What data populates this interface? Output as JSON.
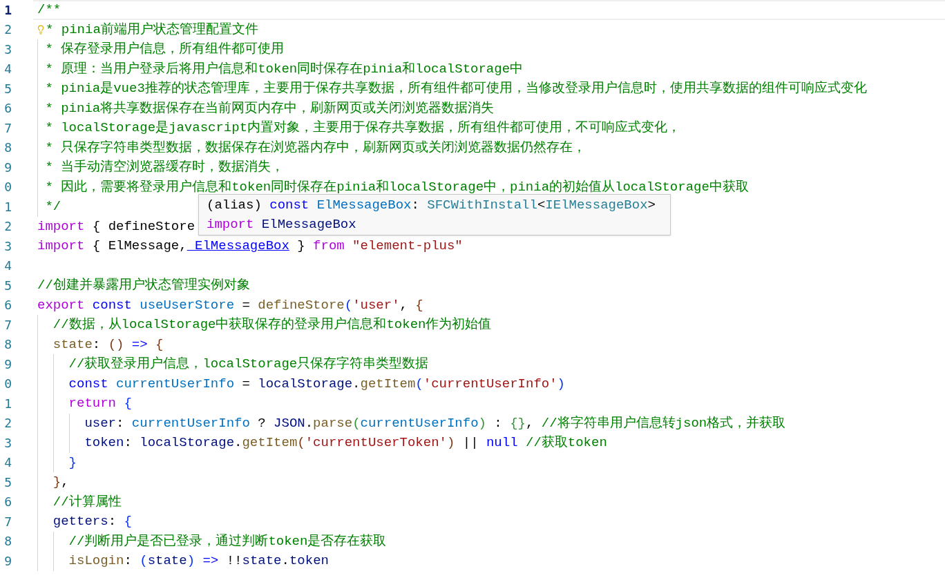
{
  "editor": {
    "lines": [
      {
        "number": "1",
        "current": true,
        "lightbulb": false,
        "tokens": [
          {
            "text": "/**",
            "kind": "comment"
          }
        ]
      },
      {
        "number": "2",
        "current": false,
        "lightbulb": true,
        "tokens": [
          {
            "text": "* pinia前端用户状态管理配置文件",
            "kind": "comment"
          }
        ]
      },
      {
        "number": "3",
        "current": false,
        "lightbulb": false,
        "tokens": [
          {
            "text": " * 保存登录用户信息，所有组件都可使用",
            "kind": "comment"
          }
        ]
      },
      {
        "number": "4",
        "current": false,
        "lightbulb": false,
        "tokens": [
          {
            "text": " * 原理：当用户登录后将用户信息和token同时保存在pinia和localStorage中",
            "kind": "comment"
          }
        ]
      },
      {
        "number": "5",
        "current": false,
        "lightbulb": false,
        "tokens": [
          {
            "text": " * pinia是vue3推荐的状态管理库，主要用于保存共享数据，所有组件都可使用，当修改登录用户信息时，使用共享数据的组件可响应式变化",
            "kind": "comment"
          }
        ]
      },
      {
        "number": "6",
        "current": false,
        "lightbulb": false,
        "tokens": [
          {
            "text": " * pinia将共享数据保存在当前网页内存中，刷新网页或关闭浏览器数据消失",
            "kind": "comment"
          }
        ]
      },
      {
        "number": "7",
        "current": false,
        "lightbulb": false,
        "tokens": [
          {
            "text": " * localStorage是javascript内置对象，主要用于保存共享数据，所有组件都可使用，不可响应式变化，",
            "kind": "comment"
          }
        ]
      },
      {
        "number": "8",
        "current": false,
        "lightbulb": false,
        "tokens": [
          {
            "text": " * 只保存字符串类型数据，数据保存在浏览器内存中，刷新网页或关闭浏览器数据仍然存在，",
            "kind": "comment"
          }
        ]
      },
      {
        "number": "9",
        "current": false,
        "lightbulb": false,
        "tokens": [
          {
            "text": " * 当手动清空浏览器缓存时，数据消失，",
            "kind": "comment"
          }
        ]
      },
      {
        "number": "0",
        "current": false,
        "lightbulb": false,
        "tokens": [
          {
            "text": " * 因此，需要将登录用户信息和token同时保存在pinia和localStorage中，pinia的初始值从localStorage中获取",
            "kind": "comment"
          }
        ]
      },
      {
        "number": "1",
        "current": false,
        "lightbulb": false,
        "tokens": [
          {
            "text": " */",
            "kind": "comment"
          }
        ]
      },
      {
        "number": "2",
        "current": false,
        "lightbulb": false,
        "tokens": [
          {
            "text": "import",
            "kind": "keyword"
          },
          {
            "text": " { defineStore",
            "kind": "plain"
          }
        ]
      },
      {
        "number": "3",
        "current": false,
        "lightbulb": false,
        "tokens": [
          {
            "text": "import",
            "kind": "keyword"
          },
          {
            "text": " { ElMessage,",
            "kind": "plain"
          },
          {
            "text": " ElMessageBox",
            "kind": "link"
          },
          {
            "text": " }",
            "kind": "plain"
          },
          {
            "text": " from",
            "kind": "keyword"
          },
          {
            "text": " \"element-plus\"",
            "kind": "string"
          }
        ]
      },
      {
        "number": "4",
        "current": false,
        "lightbulb": false
      },
      {
        "number": "5",
        "current": false,
        "lightbulb": false,
        "tokens": [
          {
            "text": "//创建并暴露用户状态管理实例对象",
            "kind": "comment"
          }
        ]
      },
      {
        "number": "6",
        "current": false,
        "lightbulb": false,
        "tokens": [
          {
            "text": "export",
            "kind": "keyword"
          },
          {
            "text": " const",
            "kind": "storage"
          },
          {
            "text": " useUserStore",
            "kind": "constant"
          },
          {
            "text": " =",
            "kind": "plain"
          },
          {
            "text": " defineStore",
            "kind": "function"
          },
          {
            "text": "(",
            "kind": "bracket_blue"
          },
          {
            "text": "'user'",
            "kind": "string"
          },
          {
            "text": ",",
            "kind": "plain"
          },
          {
            "text": " {",
            "kind": "bracket_brown"
          }
        ]
      },
      {
        "number": "7",
        "current": false,
        "lightbulb": false,
        "tokens": [
          {
            "text": "  //数据，从localStorage中获取保存的登录用户信息和token作为初始值",
            "kind": "comment"
          }
        ]
      },
      {
        "number": "8",
        "current": false,
        "lightbulb": false,
        "tokens": [
          {
            "text": "  state",
            "kind": "function"
          },
          {
            "text": ":",
            "kind": "plain"
          },
          {
            "text": " ()",
            "kind": "bracket_brown"
          },
          {
            "text": " =>",
            "kind": "storage"
          },
          {
            "text": " {",
            "kind": "bracket_brown"
          }
        ]
      },
      {
        "number": "9",
        "current": false,
        "lightbulb": false,
        "tokens": [
          {
            "text": "    //获取登录用户信息，localStorage只保存字符串类型数据",
            "kind": "comment"
          }
        ]
      },
      {
        "number": "0",
        "current": false,
        "lightbulb": false,
        "tokens": [
          {
            "text": "    const",
            "kind": "storage"
          },
          {
            "text": " currentUserInfo",
            "kind": "constant"
          },
          {
            "text": " =",
            "kind": "plain"
          },
          {
            "text": " localStorage",
            "kind": "variable"
          },
          {
            "text": ".",
            "kind": "plain"
          },
          {
            "text": "getItem",
            "kind": "function"
          },
          {
            "text": "(",
            "kind": "bracket_blue"
          },
          {
            "text": "'currentUserInfo'",
            "kind": "string"
          },
          {
            "text": ")",
            "kind": "bracket_blue"
          }
        ]
      },
      {
        "number": "1",
        "current": false,
        "lightbulb": false,
        "tokens": [
          {
            "text": "    return",
            "kind": "keyword"
          },
          {
            "text": " {",
            "kind": "bracket_blue"
          }
        ]
      },
      {
        "number": "2",
        "current": false,
        "lightbulb": false,
        "tokens": [
          {
            "text": "      user",
            "kind": "variable"
          },
          {
            "text": ":",
            "kind": "plain"
          },
          {
            "text": " currentUserInfo",
            "kind": "constant"
          },
          {
            "text": " ? ",
            "kind": "plain"
          },
          {
            "text": "JSON",
            "kind": "variable"
          },
          {
            "text": ".",
            "kind": "plain"
          },
          {
            "text": "parse",
            "kind": "function"
          },
          {
            "text": "(",
            "kind": "bracket_green"
          },
          {
            "text": "currentUserInfo",
            "kind": "constant"
          },
          {
            "text": ")",
            "kind": "bracket_green"
          },
          {
            "text": " :",
            "kind": "plain"
          },
          {
            "text": " {}",
            "kind": "bracket_green"
          },
          {
            "text": ",",
            "kind": "plain"
          },
          {
            "text": " //将字符串用户信息转json格式，并获取",
            "kind": "comment"
          }
        ]
      },
      {
        "number": "3",
        "current": false,
        "lightbulb": false,
        "tokens": [
          {
            "text": "      token",
            "kind": "variable"
          },
          {
            "text": ":",
            "kind": "plain"
          },
          {
            "text": " localStorage",
            "kind": "variable"
          },
          {
            "text": ".",
            "kind": "plain"
          },
          {
            "text": "getItem",
            "kind": "function"
          },
          {
            "text": "(",
            "kind": "bracket_brown"
          },
          {
            "text": "'currentUserToken'",
            "kind": "string"
          },
          {
            "text": ")",
            "kind": "bracket_brown"
          },
          {
            "text": " ||",
            "kind": "plain"
          },
          {
            "text": " null",
            "kind": "storage"
          },
          {
            "text": " //获取token",
            "kind": "comment"
          }
        ]
      },
      {
        "number": "4",
        "current": false,
        "lightbulb": false,
        "tokens": [
          {
            "text": "    }",
            "kind": "bracket_blue"
          }
        ]
      },
      {
        "number": "5",
        "current": false,
        "lightbulb": false,
        "tokens": [
          {
            "text": "  }",
            "kind": "bracket_brown"
          },
          {
            "text": ",",
            "kind": "plain"
          }
        ]
      },
      {
        "number": "6",
        "current": false,
        "lightbulb": false,
        "tokens": [
          {
            "text": "  //计算属性",
            "kind": "comment"
          }
        ]
      },
      {
        "number": "7",
        "current": false,
        "lightbulb": false,
        "tokens": [
          {
            "text": "  getters",
            "kind": "variable"
          },
          {
            "text": ":",
            "kind": "plain"
          },
          {
            "text": " {",
            "kind": "bracket_blue"
          }
        ]
      },
      {
        "number": "8",
        "current": false,
        "lightbulb": false,
        "tokens": [
          {
            "text": "    //判断用户是否已登录，通过判断token是否存在获取",
            "kind": "comment"
          }
        ]
      },
      {
        "number": "9",
        "current": false,
        "lightbulb": false,
        "tokens": [
          {
            "text": "    isLogin",
            "kind": "function"
          },
          {
            "text": ":",
            "kind": "plain"
          },
          {
            "text": " (",
            "kind": "bracket_blue"
          },
          {
            "text": "state",
            "kind": "variable"
          },
          {
            "text": ")",
            "kind": "bracket_blue"
          },
          {
            "text": " =>",
            "kind": "storage"
          },
          {
            "text": " !!",
            "kind": "plain"
          },
          {
            "text": "state",
            "kind": "variable"
          },
          {
            "text": ".",
            "kind": "plain"
          },
          {
            "text": "token",
            "kind": "variable"
          }
        ]
      }
    ]
  },
  "hover_tooltip": {
    "lines": [
      {
        "tokens": [
          {
            "text": "(alias)",
            "kind": "plain"
          },
          {
            "text": " const",
            "kind": "storage"
          },
          {
            "text": " ElMessageBox",
            "kind": "constant"
          },
          {
            "text": ":",
            "kind": "plain"
          },
          {
            "text": " SFCWithInstall",
            "kind": "type"
          },
          {
            "text": "<",
            "kind": "plain"
          },
          {
            "text": "IElMessageBox",
            "kind": "type"
          },
          {
            "text": ">",
            "kind": "plain"
          }
        ]
      },
      {
        "tokens": [
          {
            "text": "import",
            "kind": "keyword"
          },
          {
            "text": " ElMessageBox",
            "kind": "variable"
          }
        ]
      }
    ]
  }
}
